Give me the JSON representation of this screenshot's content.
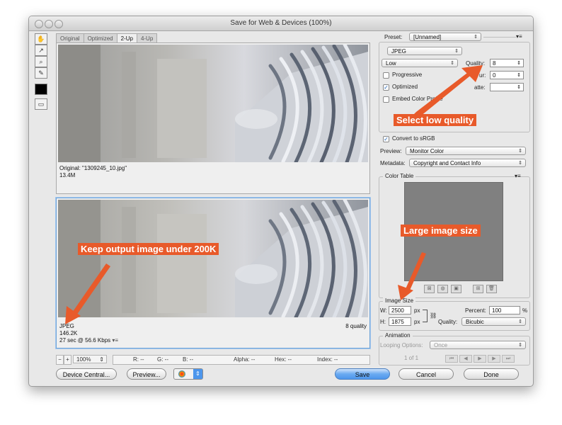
{
  "window": {
    "title": "Save for Web & Devices (100%)"
  },
  "tools": [
    "hand-icon",
    "slice-select-icon",
    "zoom-icon",
    "eyedropper-icon"
  ],
  "tabs": [
    {
      "label": "Original",
      "active": false
    },
    {
      "label": "Optimized",
      "active": false
    },
    {
      "label": "2-Up",
      "active": true
    },
    {
      "label": "4-Up",
      "active": false
    }
  ],
  "top_pane": {
    "name": "Original: \"1309245_10.jpg\"",
    "size": "13.4M"
  },
  "bottom_pane": {
    "format": "JPEG",
    "size": "146.2K",
    "time": "27 sec @ 56.6 Kbps",
    "quality": "8 quality"
  },
  "statusbar": {
    "zoom": "100%",
    "r": "R: --",
    "g": "G: --",
    "b": "B: --",
    "alpha": "Alpha: --",
    "hex": "Hex: --",
    "index": "Index: --"
  },
  "buttons": {
    "device_central": "Device Central...",
    "preview": "Preview...",
    "save": "Save",
    "cancel": "Cancel",
    "done": "Done"
  },
  "settings": {
    "preset_label": "Preset:",
    "preset_value": "[Unnamed]",
    "format": "JPEG",
    "compression": "Low",
    "quality_label": "Quality:",
    "quality_value": "8",
    "progressive": "Progressive",
    "blur_label": "ur:",
    "blur_value": "0",
    "optimized": "Optimized",
    "matte_label": "atte:",
    "embed_profile": "Embed Color Profile",
    "convert_srgb": "Convert to sRGB",
    "preview_label": "Preview:",
    "preview_value": "Monitor Color",
    "metadata_label": "Metadata:",
    "metadata_value": "Copyright and Contact Info"
  },
  "color_table": {
    "legend": "Color Table"
  },
  "image_size": {
    "legend": "Image Size",
    "w_label": "W:",
    "w_value": "2500",
    "h_label": "H:",
    "h_value": "1875",
    "unit": "px",
    "percent_label": "Percent:",
    "percent_value": "100",
    "percent_unit": "%",
    "quality_label": "Quality:",
    "quality_value": "Bicubic"
  },
  "animation": {
    "legend": "Animation",
    "looping_label": "Looping Options:",
    "looping_value": "Once",
    "frame": "1 of 1"
  },
  "annotations": {
    "low_quality": "Select low quality",
    "large_size": "Large image size",
    "under_200k": "Keep output image under 200K"
  },
  "colors": {
    "annotation": "#e85a2a",
    "save_button": "#5a9ff0",
    "color_table": "#808080"
  }
}
